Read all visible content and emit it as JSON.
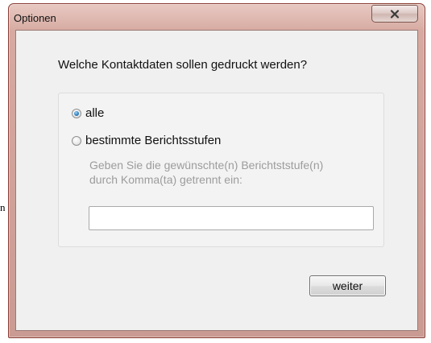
{
  "side_glyph": "n",
  "window": {
    "title": "Optionen",
    "close_icon": "close-x-icon"
  },
  "dialog": {
    "question": "Welche Kontaktdaten sollen gedruckt werden?",
    "options": [
      {
        "label": "alle",
        "checked": true
      },
      {
        "label": "bestimmte Berichtsstufen",
        "checked": false
      }
    ],
    "hint_line1": "Geben Sie die gewünschte(n) Berichtststufe(n)",
    "hint_line2": "durch Komma(ta) getrennt ein:",
    "input_value": "",
    "continue_label": "weiter"
  },
  "colors": {
    "frame": "#d6aaa1",
    "client": "#f0f0f0",
    "radio_selected": "#2f7fbf",
    "hint_text": "#9c9c9c"
  }
}
